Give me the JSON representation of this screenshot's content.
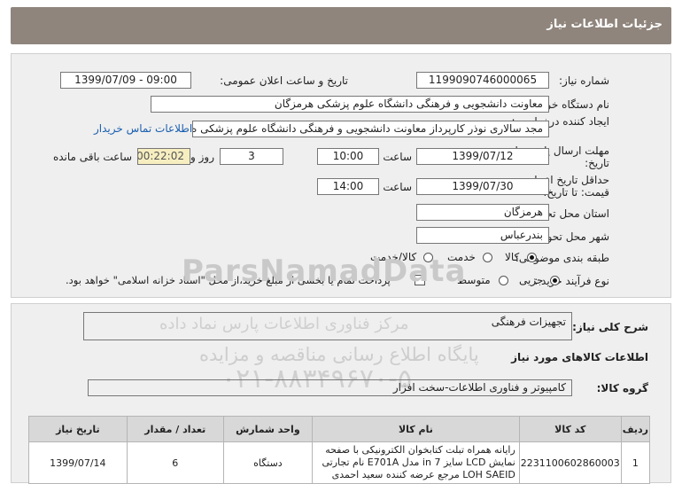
{
  "header": {
    "title": "جزئیات اطلاعات نیاز"
  },
  "form": {
    "need_number_label": "شماره نیاز:",
    "need_number": "1199090746000065",
    "announce_label": "تاریخ و ساعت اعلان عمومی:",
    "announce_value": "1399/07/09 - 09:00",
    "buyer_label": "نام دستگاه خریدار:",
    "buyer_value": "معاونت دانشجویی و فرهنگی دانشگاه علوم پزشکی هرمزگان",
    "creator_label": "ایجاد کننده درخواست:",
    "creator_value": "مجد سالاری نوذر کارپرداز معاونت دانشجویی و فرهنگی دانشگاه علوم پزشکی ه",
    "contact_link": "اطلاعات تماس خریدار",
    "send_deadline_label": "مهلت ارسال پاسخ: تا تاریخ:",
    "send_date": "1399/07/12",
    "time_label": "ساعت",
    "send_time": "10:00",
    "days_value": "3",
    "days_label": "روز و",
    "remaining_time": "00:22:02",
    "remaining_label": "ساعت باقی مانده",
    "validity_label": "حداقل تاریخ اعتبار قیمت: تا تاریخ:",
    "validity_date": "1399/07/30",
    "validity_time": "14:00",
    "province_label": "استان محل تحویل:",
    "province_value": "هرمزگان",
    "city_label": "شهر محل تحویل:",
    "city_value": "بندرعباس",
    "category_label": "طبقه بندی موضوعی:",
    "category_options": [
      "کالا",
      "خدمت",
      "کالا/خدمت"
    ],
    "category_selected": "کالا",
    "process_label": "نوع فرآیند خرید :",
    "process_options": [
      "جزیی",
      "متوسط"
    ],
    "process_selected": "جزیی",
    "payment_note": "پرداخت تمام یا بخشی از مبلغ خرید،از محل \"اسناد خزانه اسلامی\" خواهد بود."
  },
  "summary": {
    "description_label": "شرح کلی نیاز:",
    "description_value": "تجهیزات فرهنگی",
    "goods_info_title": "اطلاعات کالاهای مورد نیاز",
    "goods_group_label": "گروه کالا:",
    "goods_group_value": "کامپیوتر و فناوری اطلاعات-سخت افزار"
  },
  "table": {
    "headers": [
      "ردیف",
      "کد کالا",
      "نام کالا",
      "واحد شمارش",
      "تعداد / مقدار",
      "تاریخ نیاز"
    ],
    "rows": [
      {
        "row": "1",
        "code": "2231100602860003",
        "name": "رایانه همراه تبلت کتابخوان الکترونیکی با صفحه نمایش LCD سایز 7 in مدل E701A نام تجارتی LOH SAEID مرجع عرضه کننده سعید احمدی",
        "unit": "دستگاه",
        "qty": "6",
        "date": "1399/07/14"
      }
    ]
  },
  "watermark": {
    "brand": "ParsNamadData",
    "line1": "پایگاه اطلاع رسانی مناقصه و مزایده",
    "line2": "مرکز فناوری اطلاعات پارس نماد داده",
    "phone": "۰۲۱-۸۸۳۴۹۶۷۰-۵"
  },
  "colors": {
    "title_bar": "#8f857c",
    "panel": "#efefef",
    "remaining_bg": "#f6eec0",
    "link": "#1a5fb0"
  }
}
